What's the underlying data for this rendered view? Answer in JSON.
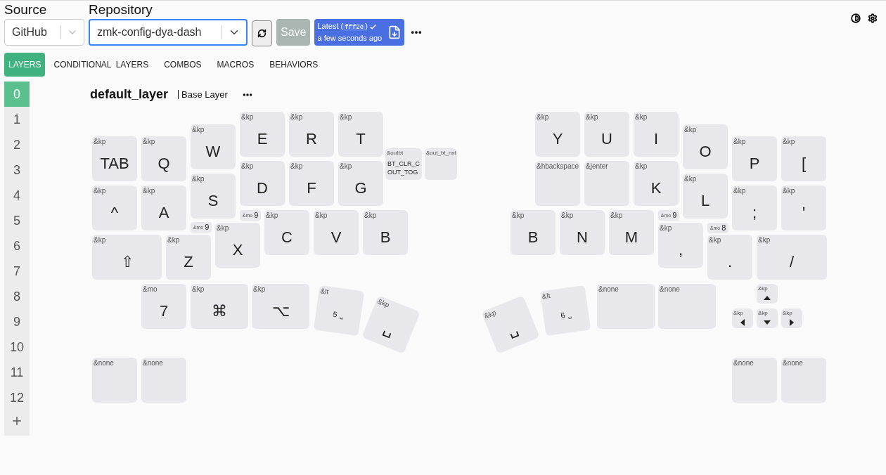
{
  "header": {
    "source": {
      "label": "Source",
      "value": "GitHub"
    },
    "repository": {
      "label": "Repository",
      "value": "zmk-config-dya-dash"
    },
    "save": {
      "label": "Save",
      "disabled": true
    },
    "latest": {
      "label": "Latest (",
      "commit": "fff2e",
      "close": ")",
      "time": "a few seconds ago"
    }
  },
  "tabs": [
    {
      "label": "LAYERS",
      "selected": true
    },
    {
      "label": "CONDITIONAL  LAYERS",
      "selected": false
    },
    {
      "label": "COMBOS",
      "selected": false
    },
    {
      "label": "MACROS",
      "selected": false
    },
    {
      "label": "BEHAVIORS",
      "selected": false
    }
  ],
  "layers": [
    {
      "label": "0",
      "selected": true
    },
    {
      "label": "1",
      "selected": false
    },
    {
      "label": "2",
      "selected": false
    },
    {
      "label": "3",
      "selected": false
    },
    {
      "label": "4",
      "selected": false
    },
    {
      "label": "5",
      "selected": false
    },
    {
      "label": "6",
      "selected": false
    },
    {
      "label": "7",
      "selected": false
    },
    {
      "label": "8",
      "selected": false
    },
    {
      "label": "9",
      "selected": false
    },
    {
      "label": "10",
      "selected": false
    },
    {
      "label": "11",
      "selected": false
    },
    {
      "label": "12",
      "selected": false
    }
  ],
  "layer": {
    "name": "default_layer",
    "label": "Base Layer"
  },
  "halves": [
    {
      "keys": [
        {
          "behavior": "&kp",
          "label": "TAB"
        },
        {
          "behavior": "&kp",
          "label": "Q"
        },
        {
          "behavior": "&kp",
          "label": "W"
        },
        {
          "behavior": "&kp",
          "label": "E"
        },
        {
          "behavior": "&kp",
          "label": "R"
        },
        {
          "behavior": "&kp",
          "label": "T"
        },
        {
          "behavior": "&outbt",
          "lines": [
            "BT_CLR_C",
            "OUT_TOG"
          ]
        },
        {
          "behavior": "&out_bt_nxt"
        },
        {
          "behavior": "&kp",
          "label": "^"
        },
        {
          "behavior": "&kp",
          "label": "A"
        },
        {
          "behavior": "&kp",
          "label": "S"
        },
        {
          "behavior": "&kp",
          "label": "D"
        },
        {
          "behavior": "&kp",
          "label": "F"
        },
        {
          "behavior": "&kp",
          "label": "G"
        },
        {
          "behavior": "&kp",
          "label": "⇧"
        },
        {
          "behavior": "&kp",
          "label": "Z"
        },
        {
          "behavior": "&mo",
          "label": "9"
        },
        {
          "behavior": "&kp",
          "label": "X"
        },
        {
          "behavior": "&mo",
          "label": "9"
        },
        {
          "behavior": "&kp",
          "label": "C"
        },
        {
          "behavior": "&kp",
          "label": "V"
        },
        {
          "behavior": "&kp",
          "label": "B"
        },
        {
          "behavior": "&mo",
          "label": "7"
        },
        {
          "behavior": "&kp",
          "label": "⌘"
        },
        {
          "behavior": "&kp",
          "label": "⌥"
        },
        {
          "behavior": "&lt",
          "label": "5",
          "sub": "␣"
        },
        {
          "behavior": "&kp",
          "label": "␣"
        },
        {
          "behavior": "&none"
        },
        {
          "behavior": "&none"
        }
      ]
    },
    {
      "keys": [
        {
          "behavior": "&kp",
          "label": "Y"
        },
        {
          "behavior": "&kp",
          "label": "U"
        },
        {
          "behavior": "&kp",
          "label": "I"
        },
        {
          "behavior": "&hbackspace"
        },
        {
          "behavior": "&jenter"
        },
        {
          "behavior": "&kp",
          "label": "K"
        },
        {
          "behavior": "&kp",
          "label": "B"
        },
        {
          "behavior": "&kp",
          "label": "N"
        },
        {
          "behavior": "&kp",
          "label": "M"
        },
        {
          "behavior": "&mo",
          "label": "9"
        },
        {
          "behavior": "&kp",
          "label": "O"
        },
        {
          "behavior": "&kp",
          "label": "L"
        },
        {
          "behavior": "&kp",
          "label": ","
        },
        {
          "behavior": "&mo",
          "label": "8"
        },
        {
          "behavior": "&kp",
          "label": "."
        },
        {
          "behavior": "&kp",
          "label": "P"
        },
        {
          "behavior": "&kp",
          "label": ";"
        },
        {
          "behavior": "&kp",
          "label": "/"
        },
        {
          "behavior": "&kp",
          "label": "["
        },
        {
          "behavior": "&kp",
          "label": "'"
        },
        {
          "behavior": "&kp",
          "label": "␣"
        },
        {
          "behavior": "&lt",
          "label": "6",
          "sub": "␣"
        },
        {
          "behavior": "&none"
        },
        {
          "behavior": "&none"
        },
        {
          "behavior": "&kp",
          "kind": "arrow"
        },
        {
          "behavior": "&kp",
          "kind": "arrow"
        },
        {
          "behavior": "&kp",
          "kind": "arrow"
        },
        {
          "behavior": "&kp",
          "kind": "arrow"
        },
        {
          "behavior": "&none"
        },
        {
          "behavior": "&none"
        }
      ]
    }
  ]
}
